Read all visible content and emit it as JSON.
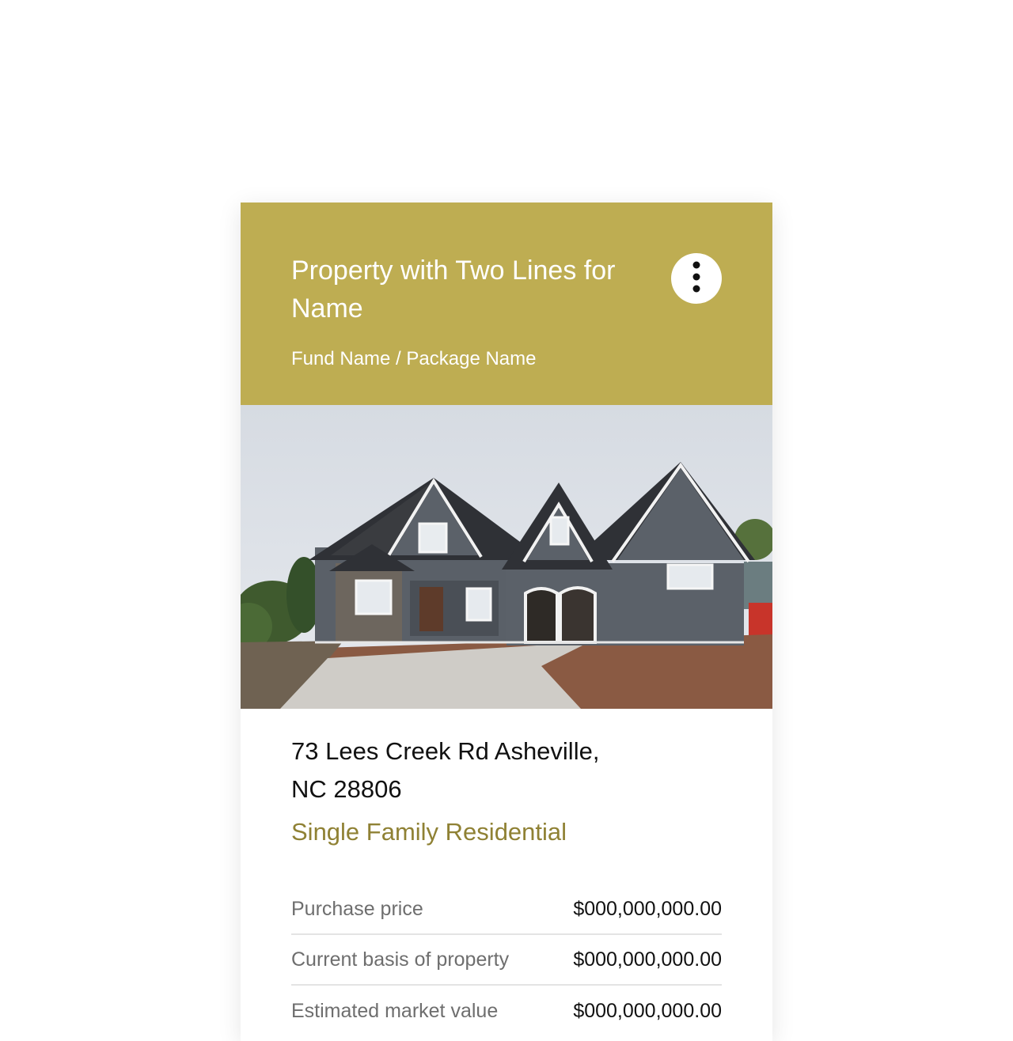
{
  "header": {
    "title": "Property with Two Lines for Name",
    "subtitle": "Fund Name / Package Name",
    "background_color": "#bead52",
    "menu_icon": "more-vertical-icon"
  },
  "property": {
    "photo_description": "house-photo",
    "address": "73 Lees Creek Rd Asheville, NC 28806",
    "type": "Single Family Residential",
    "type_color": "#8f8134"
  },
  "financials": [
    {
      "label": "Purchase price",
      "value": "$000,000,000.00"
    },
    {
      "label": "Current basis of property",
      "value": "$000,000,000.00"
    },
    {
      "label": "Estimated market value",
      "value": "$000,000,000.00"
    }
  ]
}
